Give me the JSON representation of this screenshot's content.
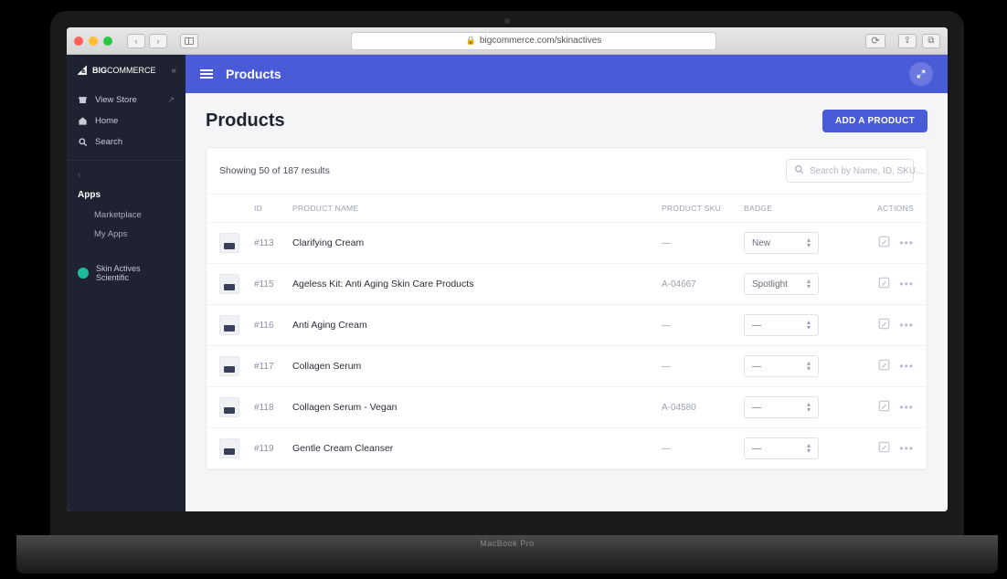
{
  "browser": {
    "url": "bigcommerce.com/skinactives"
  },
  "laptop_label": "MacBook Pro",
  "brand": {
    "prefix": "BIG",
    "suffix": "COMMERCE"
  },
  "sidebar": {
    "view_store": "View Store",
    "home": "Home",
    "search": "Search",
    "back": "‹",
    "apps_title": "Apps",
    "marketplace": "Marketplace",
    "my_apps": "My Apps",
    "store_name": "Skin Actives Scientific"
  },
  "topbar": {
    "title": "Products"
  },
  "page": {
    "title": "Products",
    "add_button": "ADD A PRODUCT",
    "results_text": "Showing 50 of 187 results",
    "search_placeholder": "Search by Name, ID, SKU..."
  },
  "columns": {
    "id": "ID",
    "name": "PRODUCT NAME",
    "sku": "PRODUCT SKU",
    "badge": "BADGE",
    "actions": "ACTIONS"
  },
  "badge_options": {
    "empty": "—"
  },
  "products": [
    {
      "id": "#113",
      "name": "Clarifying Cream",
      "sku": "—",
      "badge": "New"
    },
    {
      "id": "#115",
      "name": "Ageless Kit: Anti Aging Skin Care Products",
      "sku": "A-04667",
      "badge": "Spotlight"
    },
    {
      "id": "#116",
      "name": "Anti Aging Cream",
      "sku": "—",
      "badge": "—"
    },
    {
      "id": "#117",
      "name": "Collagen Serum",
      "sku": "—",
      "badge": "—"
    },
    {
      "id": "#118",
      "name": "Collagen Serum - Vegan",
      "sku": "A-04580",
      "badge": "—"
    },
    {
      "id": "#119",
      "name": "Gentle Cream Cleanser",
      "sku": "—",
      "badge": "—"
    }
  ]
}
